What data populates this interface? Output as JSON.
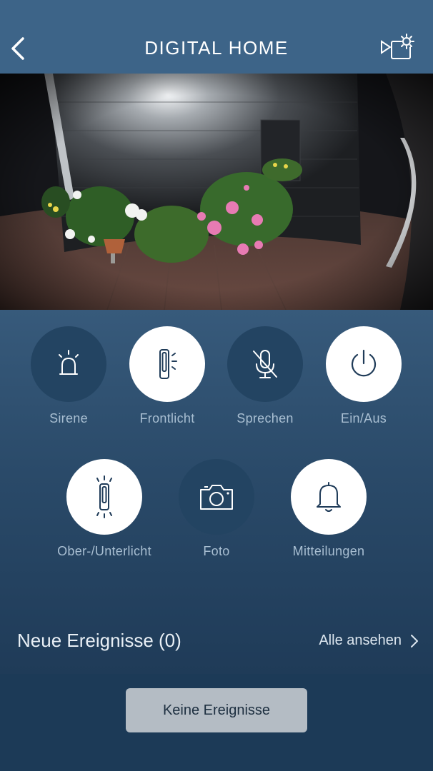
{
  "header": {
    "title": "DIGITAL HOME",
    "back_icon": "chevron-left-icon",
    "settings_icon": "camera-settings-icon"
  },
  "camera": {
    "description_icon": "live-camera-feed"
  },
  "controls": [
    {
      "label": "Sirene",
      "icon": "siren-icon",
      "active": false
    },
    {
      "label": "Frontlicht",
      "icon": "front-light-icon",
      "active": true
    },
    {
      "label": "Sprechen",
      "icon": "microphone-muted-icon",
      "active": false
    },
    {
      "label": "Ein/Aus",
      "icon": "power-icon",
      "active": true
    },
    {
      "label": "Ober-/Unterlicht",
      "icon": "up-down-light-icon",
      "active": true
    },
    {
      "label": "Foto",
      "icon": "camera-icon",
      "active": false
    },
    {
      "label": "Mitteilungen",
      "icon": "bell-icon",
      "active": true
    }
  ],
  "events": {
    "title": "Neue Ereignisse (0)",
    "see_all": "Alle ansehen",
    "empty_button": "Keine Ereignisse"
  },
  "colors": {
    "header_bg": "#3d6488",
    "active_circle": "#ffffff",
    "inactive_circle": "#234462",
    "label": "#a9bfd2",
    "button_bg": "#b4bcc4"
  }
}
